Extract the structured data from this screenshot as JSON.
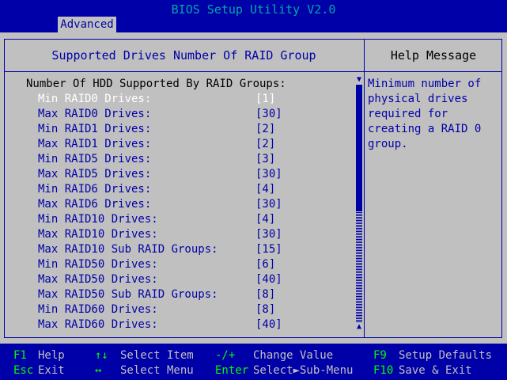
{
  "window": {
    "title": "BIOS Setup Utility V2.0"
  },
  "tabs": [
    {
      "label": "Advanced"
    }
  ],
  "panel": {
    "header": "Supported Drives Number Of RAID Group",
    "group_title": "Number Of HDD Supported By RAID Groups:",
    "rows": [
      {
        "label": "Min RAID0 Drives:",
        "value": "[1]"
      },
      {
        "label": "Max RAID0 Drives:",
        "value": "[30]"
      },
      {
        "label": "Min RAID1 Drives:",
        "value": "[2]"
      },
      {
        "label": "Max RAID1 Drives:",
        "value": "[2]"
      },
      {
        "label": "Min RAID5 Drives:",
        "value": "[3]"
      },
      {
        "label": "Max RAID5 Drives:",
        "value": "[30]"
      },
      {
        "label": "Min RAID6 Drives:",
        "value": "[4]"
      },
      {
        "label": "Max RAID6 Drives:",
        "value": "[30]"
      },
      {
        "label": "Min RAID10 Drives:",
        "value": "[4]"
      },
      {
        "label": "Max RAID10 Drives:",
        "value": "[30]"
      },
      {
        "label": "Max RAID10 Sub RAID Groups:",
        "value": "[15]"
      },
      {
        "label": "Min RAID50 Drives:",
        "value": "[6]"
      },
      {
        "label": "Max RAID50 Drives:",
        "value": "[40]"
      },
      {
        "label": "Max RAID50 Sub RAID Groups:",
        "value": "[8]"
      },
      {
        "label": "Min RAID60 Drives:",
        "value": "[8]"
      },
      {
        "label": "Max RAID60 Drives:",
        "value": "[40]"
      }
    ],
    "selected_index": 0,
    "scrollbar": {
      "up_arrow": "▼",
      "down_arrow": "▲",
      "thumb_fraction": 0.53
    }
  },
  "help": {
    "header": "Help Message",
    "lines": [
      "Minimum number of",
      "physical drives",
      "required for",
      "creating a RAID 0",
      "group."
    ]
  },
  "footer": {
    "f1": {
      "key": "F1",
      "desc": "Help"
    },
    "esc": {
      "key": "Esc",
      "desc": "Exit"
    },
    "updown": {
      "key": "↑↓",
      "desc": "Select Item"
    },
    "leftright": {
      "key": "↔",
      "desc": "Select Menu"
    },
    "change": {
      "key": "-/+",
      "desc": "Change Value"
    },
    "enter": {
      "key": "Enter",
      "desc": "Select►Sub-Menu"
    },
    "f9": {
      "key": "F9",
      "desc": "Setup Defaults"
    },
    "f10": {
      "key": "F10",
      "desc": "Save & Exit"
    }
  },
  "colors": {
    "background": "#0000a8",
    "panel": "#c0c0c0",
    "title": "#00a8a8",
    "key": "#00ff00",
    "selected": "#ffffff"
  }
}
